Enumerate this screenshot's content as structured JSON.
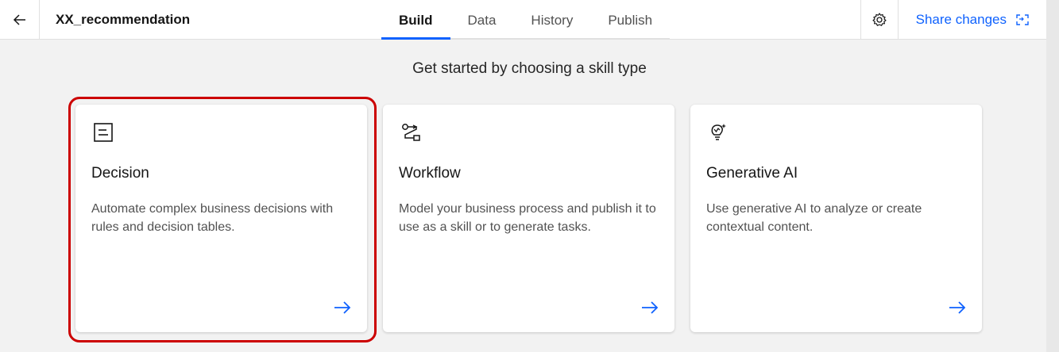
{
  "header": {
    "app_title": "XX_recommendation",
    "tabs": [
      {
        "label": "Build",
        "active": true
      },
      {
        "label": "Data",
        "active": false
      },
      {
        "label": "History",
        "active": false
      },
      {
        "label": "Publish",
        "active": false
      }
    ],
    "share_label": "Share changes"
  },
  "main": {
    "heading": "Get started by choosing a skill type",
    "cards": [
      {
        "title": "Decision",
        "description": "Automate complex business decisions with rules and decision tables.",
        "icon": "document-icon"
      },
      {
        "title": "Workflow",
        "description": "Model your business process and publish it to use as a skill or to generate tasks.",
        "icon": "workflow-icon"
      },
      {
        "title": "Generative AI",
        "description": "Use generative AI to analyze or create contextual content.",
        "icon": "lightbulb-icon"
      }
    ]
  },
  "colors": {
    "accent": "#0f62fe",
    "highlight": "#cc0000",
    "background": "#f2f2f2"
  }
}
